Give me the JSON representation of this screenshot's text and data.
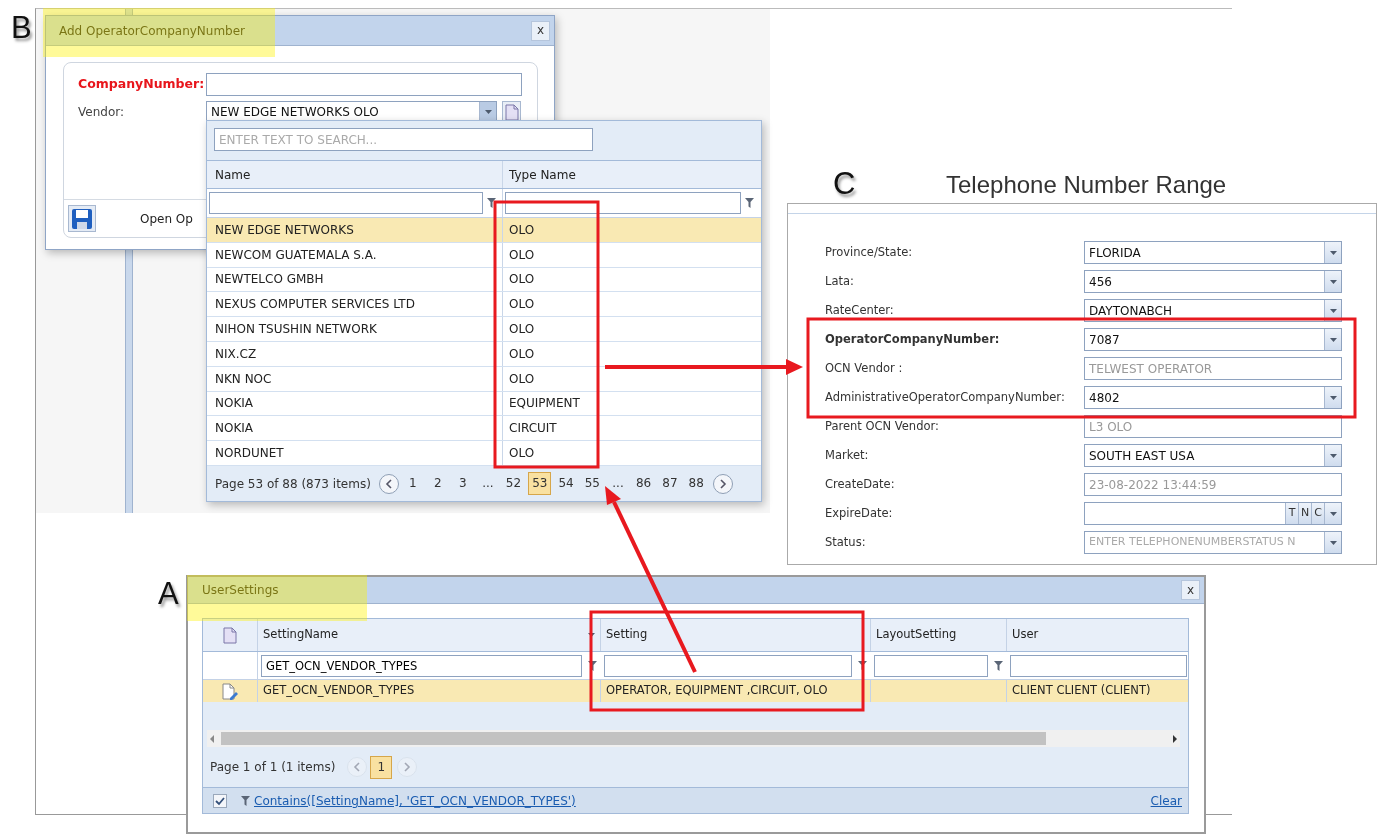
{
  "panel_b": {
    "letter": "B",
    "window": {
      "title": "Add OperatorCompanyNumber",
      "close": "x"
    },
    "fields": [
      {
        "label": "CompanyNumber:",
        "required": true,
        "kind": "text"
      },
      {
        "label": "Vendor:",
        "required": false,
        "kind": "combo",
        "value": "NEW EDGE NETWORKS OLO",
        "expanded": true
      }
    ],
    "footer_text": "Open Op",
    "dropdown": {
      "search": {
        "placeholder": "ENTER TEXT TO SEARCH..."
      },
      "columns": [
        "Name",
        "Type Name"
      ],
      "rows": [
        {
          "cells": [
            "NEW EDGE NETWORKS",
            "OLO"
          ],
          "selected": true
        },
        {
          "cells": [
            "NEWCOM GUATEMALA S.A.",
            "OLO"
          ],
          "selected": false
        },
        {
          "cells": [
            "NEWTELCO GMBH",
            "OLO"
          ],
          "selected": false
        },
        {
          "cells": [
            "NEXUS COMPUTER SERVICES LTD",
            "OLO"
          ],
          "selected": false
        },
        {
          "cells": [
            "NIHON TSUSHIN NETWORK",
            "OLO"
          ],
          "selected": false
        },
        {
          "cells": [
            "NIX.CZ",
            "OLO"
          ],
          "selected": false
        },
        {
          "cells": [
            "NKN NOC",
            "OLO"
          ],
          "selected": false
        },
        {
          "cells": [
            "NOKIA",
            "EQUIPMENT"
          ],
          "selected": false
        },
        {
          "cells": [
            "NOKIA",
            "CIRCUIT"
          ],
          "selected": false
        },
        {
          "cells": [
            "NORDUNET",
            "OLO"
          ],
          "selected": false
        }
      ],
      "pager": {
        "summary": "Page 53 of 88 (873 items)",
        "prev_disabled": false,
        "next_disabled": false,
        "pages": [
          {
            "label": "1",
            "selected": false
          },
          {
            "label": "2",
            "selected": false
          },
          {
            "label": "3",
            "selected": false
          },
          {
            "label": "...",
            "selected": false
          },
          {
            "label": "52",
            "selected": false
          },
          {
            "label": "53",
            "selected": true
          },
          {
            "label": "54",
            "selected": false
          },
          {
            "label": "55",
            "selected": false
          },
          {
            "label": "...",
            "selected": false
          },
          {
            "label": "86",
            "selected": false
          },
          {
            "label": "87",
            "selected": false
          },
          {
            "label": "88",
            "selected": false
          }
        ]
      }
    }
  },
  "panel_c": {
    "letter": "C",
    "title": "Telephone Number Range",
    "fields": [
      {
        "label": "Province/State:",
        "kind": "combo",
        "value": "FLORIDA",
        "bold": false
      },
      {
        "label": "Lata:",
        "kind": "combo",
        "value": "456",
        "bold": false
      },
      {
        "label": "RateCenter:",
        "kind": "combo",
        "value": "DAYTONABCH",
        "bold": false
      },
      {
        "label": "OperatorCompanyNumber:",
        "kind": "combo",
        "value": "7087",
        "bold": true
      },
      {
        "label": "OCN Vendor :",
        "kind": "readonly",
        "value": "TELWEST OPERATOR",
        "bold": false
      },
      {
        "label": "AdministrativeOperatorCompanyNumber:",
        "kind": "combo",
        "value": "4802",
        "bold": false
      },
      {
        "label": "Parent OCN Vendor:",
        "kind": "readonly",
        "value": "L3 OLO",
        "bold": false
      },
      {
        "label": "Market:",
        "kind": "combo",
        "value": "SOUTH EAST USA",
        "bold": false
      },
      {
        "label": "CreateDate:",
        "kind": "readonly",
        "value": "23-08-2022 13:44:59",
        "bold": false
      },
      {
        "label": "ExpireDate:",
        "kind": "date",
        "buttons": [
          "T",
          "N",
          "C"
        ],
        "bold": false
      },
      {
        "label": "Status:",
        "kind": "combo",
        "placeholder": "ENTER TELEPHONENUMBERSTATUS N",
        "bold": false
      }
    ]
  },
  "panel_a": {
    "letter": "A",
    "window": {
      "title": "UserSettings",
      "close": "x"
    },
    "grid": {
      "columns": [
        {
          "label": "SettingName",
          "sorted": true,
          "filter_value": "GET_OCN_VENDOR_TYPES"
        },
        {
          "label": "Setting",
          "sorted": false
        },
        {
          "label": "LayoutSetting",
          "sorted": false
        },
        {
          "label": "User",
          "sorted": false
        }
      ],
      "rows": [
        {
          "setting_name": "GET_OCN_VENDOR_TYPES",
          "setting": "OPERATOR, EQUIPMENT ,CIRCUIT, OLO",
          "user": "CLIENT CLIENT (CLIENT)",
          "selected": true
        }
      ],
      "pager": {
        "summary": "Page 1 of 1 (1 items)",
        "prev_disabled": true,
        "next_disabled": true,
        "pages": [
          {
            "label": "1",
            "selected": true
          }
        ]
      },
      "filter_bar": {
        "enabled": true,
        "expression": "Contains([SettingName], 'GET_OCN_VENDOR_TYPES')",
        "clear": "Clear"
      }
    }
  }
}
